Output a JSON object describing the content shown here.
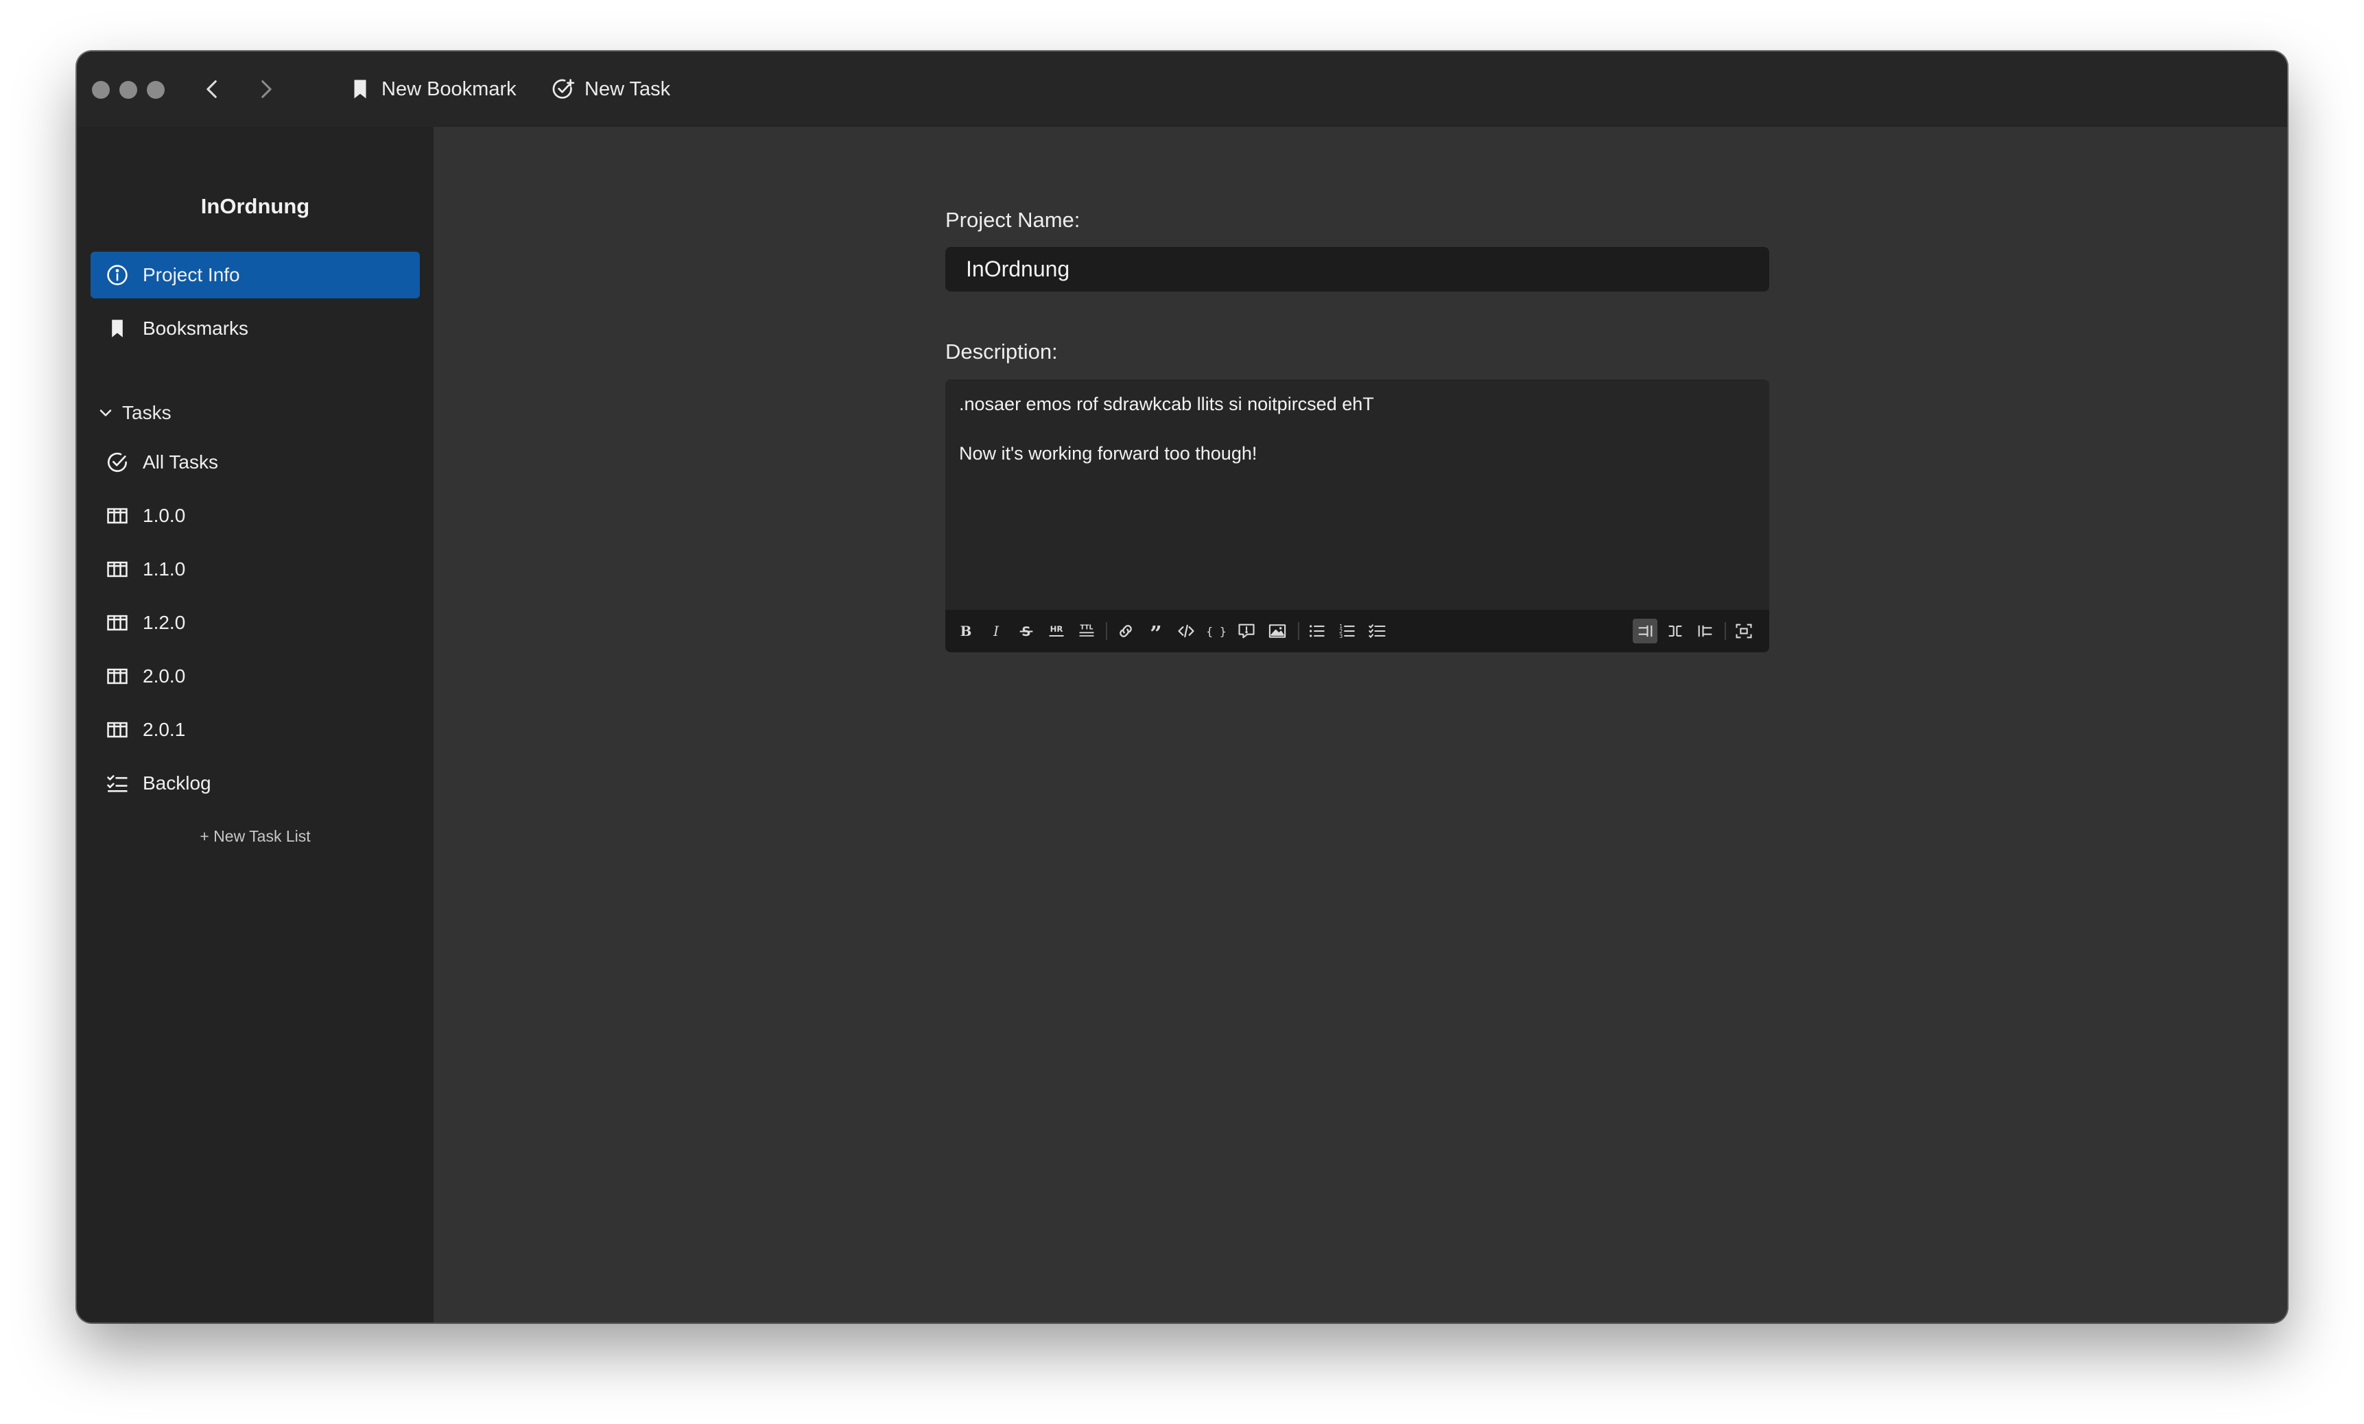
{
  "titlebar": {
    "back_icon": "chevron-left-icon",
    "forward_icon": "chevron-right-icon",
    "new_bookmark_label": "New Bookmark",
    "new_task_label": "New Task"
  },
  "sidebar": {
    "project_title": "InOrdnung",
    "project_info_label": "Project Info",
    "bookmarks_label": "Booksmarks",
    "tasks_header": "Tasks",
    "task_lists": [
      {
        "label": "All Tasks",
        "icon": "check-circle-icon"
      },
      {
        "label": "1.0.0",
        "icon": "columns-icon"
      },
      {
        "label": "1.1.0",
        "icon": "columns-icon"
      },
      {
        "label": "1.2.0",
        "icon": "columns-icon"
      },
      {
        "label": "2.0.0",
        "icon": "columns-icon"
      },
      {
        "label": "2.0.1",
        "icon": "columns-icon"
      },
      {
        "label": "Backlog",
        "icon": "checklist-icon"
      }
    ],
    "new_task_list_label": "+ New Task List"
  },
  "main": {
    "project_name_label": "Project Name:",
    "project_name_value": "InOrdnung",
    "description_label": "Description:",
    "description_lines": [
      ".nosaer emos rof sdrawkcab llits si noitpircsed ehT",
      "Now it's working forward too though!"
    ]
  },
  "editor_toolbar": {
    "buttons": [
      "bold-icon",
      "italic-icon",
      "strikethrough-icon",
      "horizontal-rule-icon",
      "title-icon",
      "link-icon",
      "quote-icon",
      "code-icon",
      "code-block-icon",
      "comment-icon",
      "image-icon",
      "unordered-list-icon",
      "ordered-list-icon",
      "checked-list-icon",
      "edit-mode-icon",
      "live-mode-icon",
      "preview-mode-icon",
      "fullscreen-icon"
    ],
    "active_mode": "edit"
  },
  "colors": {
    "accent": "#0f5aa6",
    "sidebar_bg": "#232323",
    "main_bg": "#333333",
    "titlebar_bg": "#262626",
    "input_bg": "#1c1c1c"
  }
}
